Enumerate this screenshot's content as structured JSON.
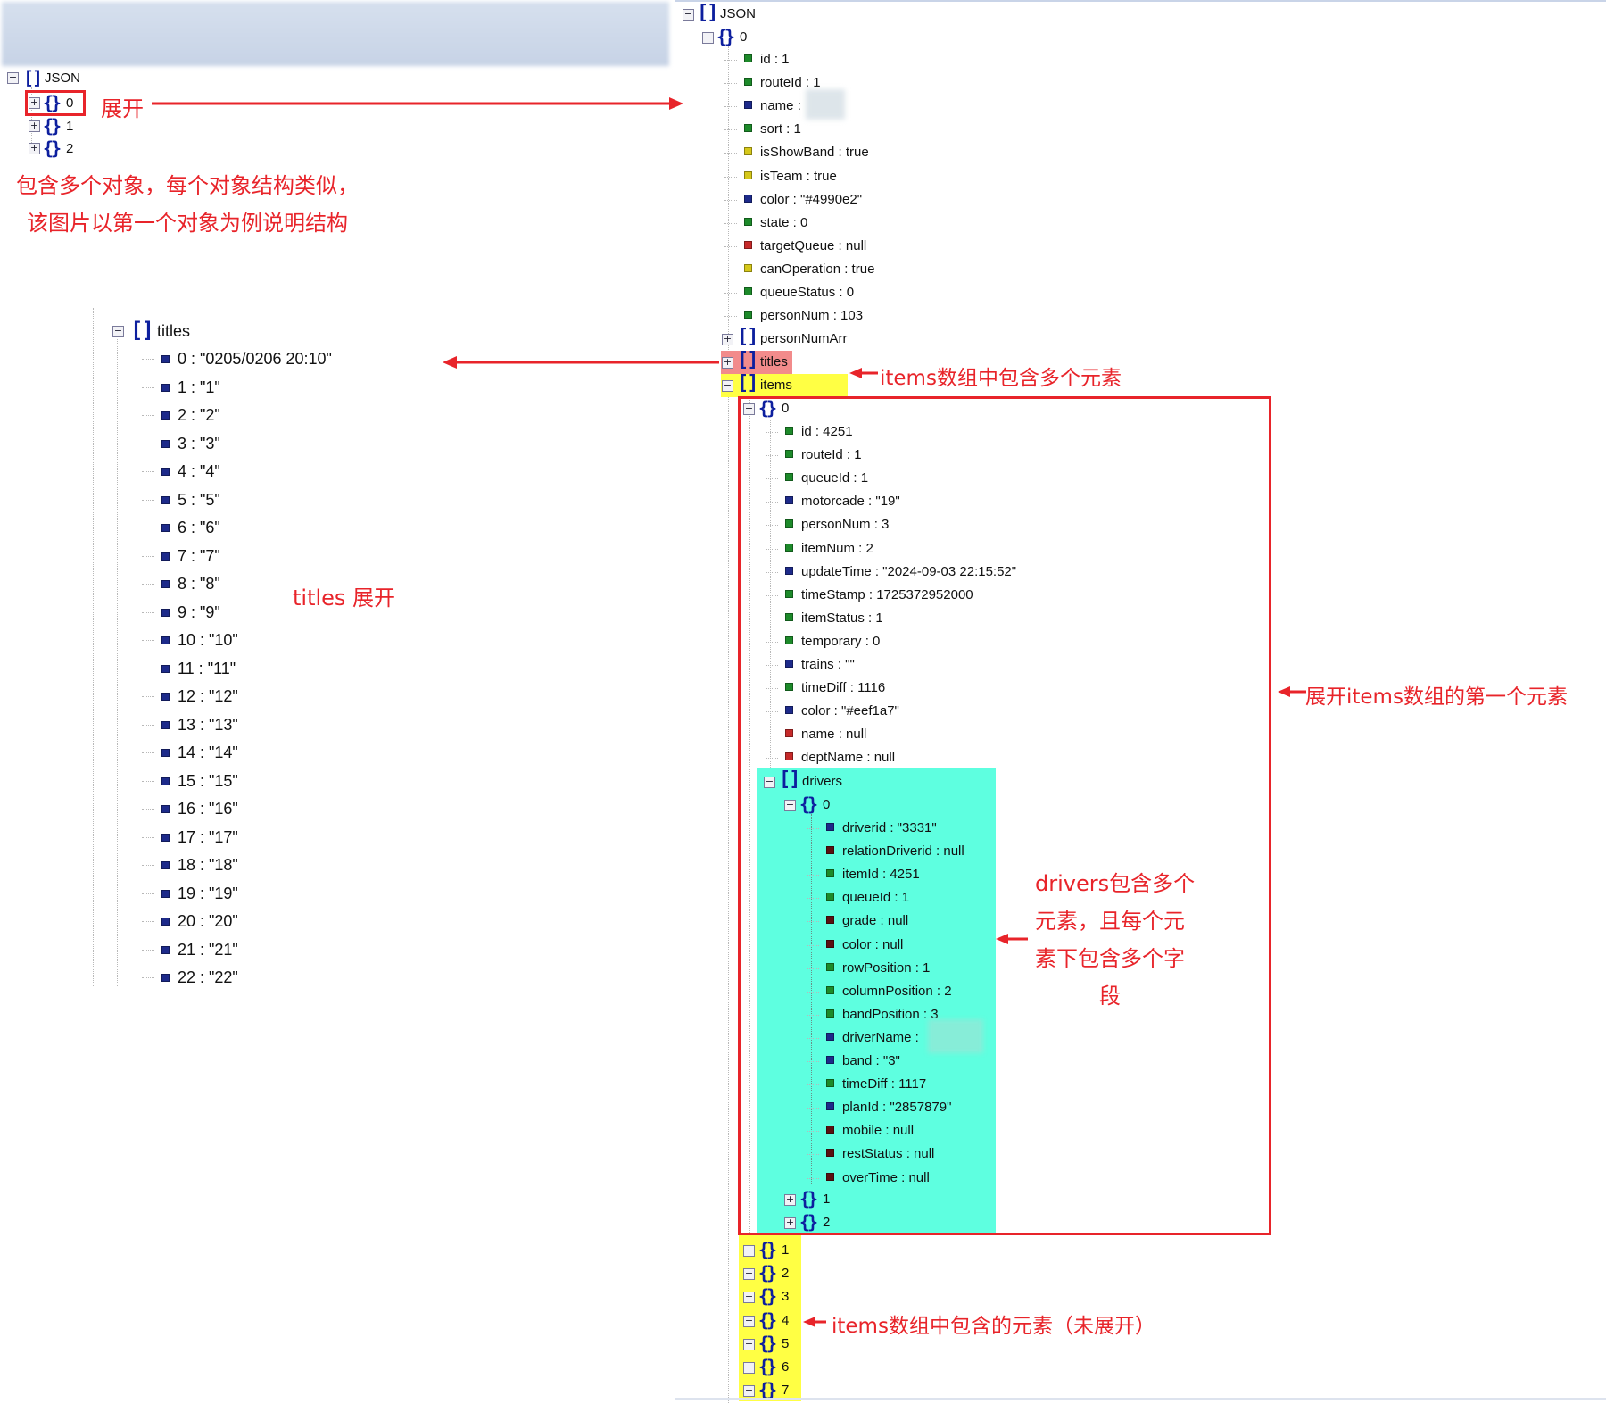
{
  "left_tree": {
    "root_label": "JSON",
    "objects": [
      "0",
      "1",
      "2"
    ]
  },
  "titles_tree": {
    "label": "titles",
    "items": [
      "0 : \"0205/0206 20:10\"",
      "1 : \"1\"",
      "2 : \"2\"",
      "3 : \"3\"",
      "4 : \"4\"",
      "5 : \"5\"",
      "6 : \"6\"",
      "7 : \"7\"",
      "8 : \"8\"",
      "9 : \"9\"",
      "10 : \"10\"",
      "11 : \"11\"",
      "12 : \"12\"",
      "13 : \"13\"",
      "14 : \"14\"",
      "15 : \"15\"",
      "16 : \"16\"",
      "17 : \"17\"",
      "18 : \"18\"",
      "19 : \"19\"",
      "20 : \"20\"",
      "21 : \"21\"",
      "22 : \"22\""
    ]
  },
  "right_tree": {
    "root_label": "JSON",
    "obj0_label": "0",
    "fields": [
      {
        "text": "id : 1",
        "type": "num"
      },
      {
        "text": "routeId : 1",
        "type": "num"
      },
      {
        "text": "name : ",
        "type": "str"
      },
      {
        "text": "sort : 1",
        "type": "num"
      },
      {
        "text": "isShowBand : true",
        "type": "bool"
      },
      {
        "text": "isTeam : true",
        "type": "bool"
      },
      {
        "text": "color : \"#4990e2\"",
        "type": "str"
      },
      {
        "text": "state : 0",
        "type": "num"
      },
      {
        "text": "targetQueue : null",
        "type": "null"
      },
      {
        "text": "canOperation : true",
        "type": "bool"
      },
      {
        "text": "queueStatus : 0",
        "type": "num"
      },
      {
        "text": "personNum : 103",
        "type": "num"
      }
    ],
    "arrays": [
      "personNumArr",
      "titles",
      "items"
    ],
    "item0_label": "0",
    "item_fields": [
      {
        "text": "id : 4251",
        "type": "num"
      },
      {
        "text": "routeId : 1",
        "type": "num"
      },
      {
        "text": "queueId : 1",
        "type": "num"
      },
      {
        "text": "motorcade : \"19\"",
        "type": "str"
      },
      {
        "text": "personNum : 3",
        "type": "num"
      },
      {
        "text": "itemNum : 2",
        "type": "num"
      },
      {
        "text": "updateTime : \"2024-09-03 22:15:52\"",
        "type": "str"
      },
      {
        "text": "timeStamp : 1725372952000",
        "type": "num"
      },
      {
        "text": "itemStatus : 1",
        "type": "num"
      },
      {
        "text": "temporary : 0",
        "type": "num"
      },
      {
        "text": "trains : \"\"",
        "type": "str"
      },
      {
        "text": "timeDiff : 1116",
        "type": "num"
      },
      {
        "text": "color : \"#eef1a7\"",
        "type": "str"
      },
      {
        "text": "name : null",
        "type": "null"
      },
      {
        "text": "deptName : null",
        "type": "null"
      }
    ],
    "drivers_label": "drivers",
    "driver0_label": "0",
    "driver_fields": [
      {
        "text": "driverid : \"3331\"",
        "type": "str"
      },
      {
        "text": "relationDriverid : null",
        "type": "null2"
      },
      {
        "text": "itemId : 4251",
        "type": "num"
      },
      {
        "text": "queueId : 1",
        "type": "num"
      },
      {
        "text": "grade : null",
        "type": "null2"
      },
      {
        "text": "color : null",
        "type": "null2"
      },
      {
        "text": "rowPosition : 1",
        "type": "num"
      },
      {
        "text": "columnPosition : 2",
        "type": "num"
      },
      {
        "text": "bandPosition : 3",
        "type": "num"
      },
      {
        "text": "driverName : ",
        "type": "str"
      },
      {
        "text": "band : \"3\"",
        "type": "str"
      },
      {
        "text": "timeDiff : 1117",
        "type": "num"
      },
      {
        "text": "planId : \"2857879\"",
        "type": "str"
      },
      {
        "text": "mobile : null",
        "type": "null2"
      },
      {
        "text": "restStatus : null",
        "type": "null2"
      },
      {
        "text": "overTime : null",
        "type": "null2"
      }
    ],
    "driver_others": [
      "1",
      "2"
    ],
    "item_others": [
      "1",
      "2",
      "3",
      "4",
      "5",
      "6",
      "7"
    ]
  },
  "annotations": {
    "expand": "展开",
    "left_desc_1": "包含多个对象，每个对象结构类似，",
    "left_desc_2": "该图片以第一个对象为例说明结构",
    "titles_expand": "titles 展开",
    "items_multi": "items数组中包含多个元素",
    "expand_first_item": "展开items数组的第一个元素",
    "drivers_desc_1": "drivers包含多个",
    "drivers_desc_2": "元素，且每个元",
    "drivers_desc_3": "素下包含多个字",
    "drivers_desc_4": "段",
    "items_unexpanded": "items数组中包含的元素（未展开）"
  },
  "colors": {
    "annotation_red": "#e8242a",
    "tree_blue": "#0d1f9e",
    "num_green": "#1d8a2a",
    "str_navy": "#1d2a8a",
    "bool_yellow": "#d6c81a",
    "null_red": "#c62a2a",
    "null_dark": "#5a1010",
    "highlight_yellow": "#ffff44",
    "highlight_pink": "#f28b8b",
    "highlight_cyan": "#5effe0"
  }
}
